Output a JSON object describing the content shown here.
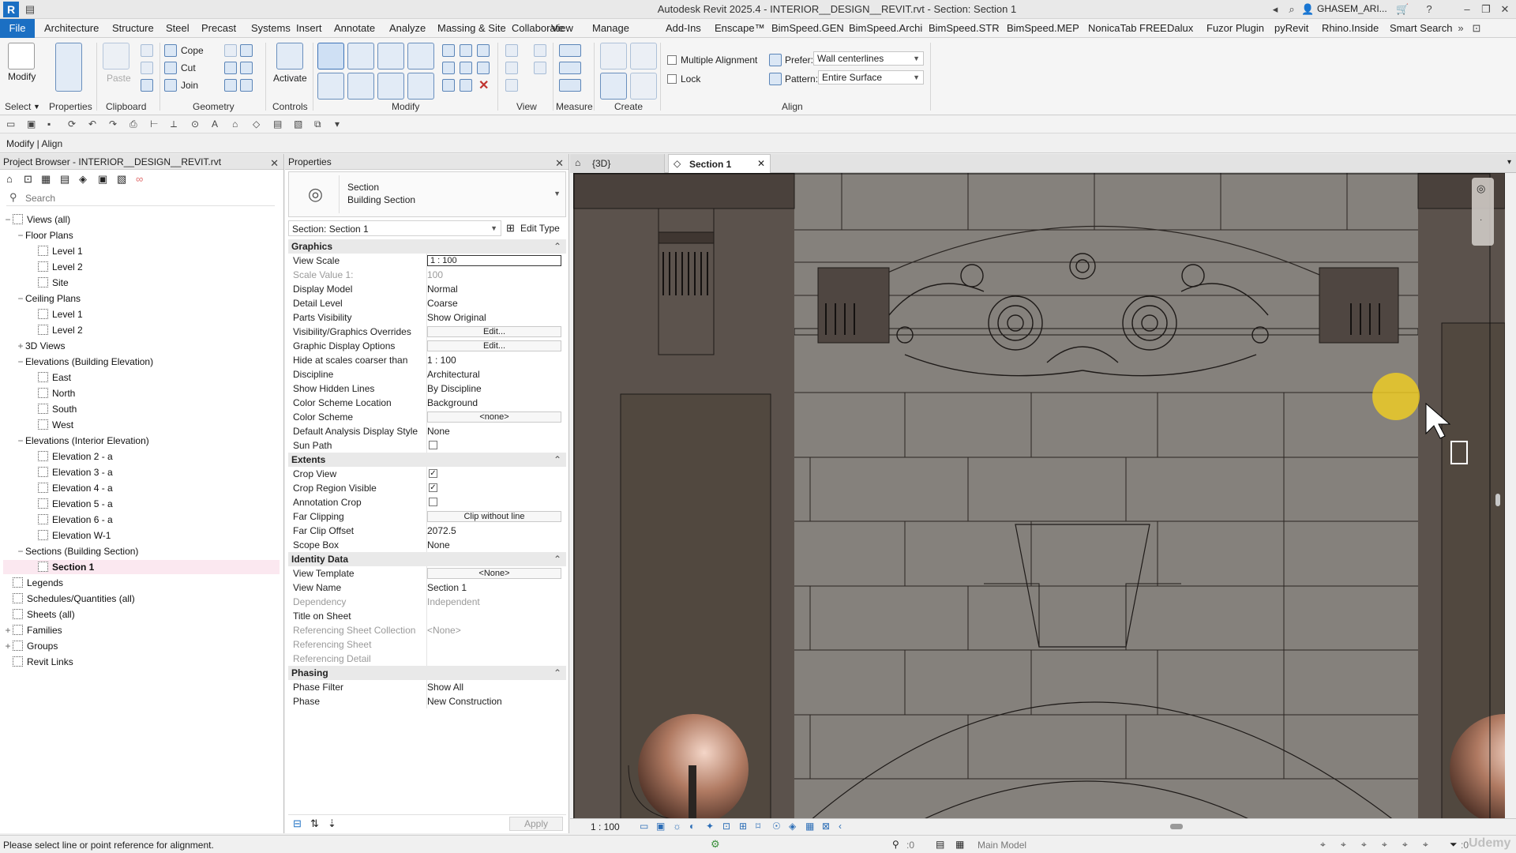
{
  "app": {
    "title": "Autodesk Revit 2025.4 - INTERIOR__DESIGN__REVIT.rvt - Section: Section 1",
    "user": "GHASEM_ARI...",
    "logo_letter": "R"
  },
  "menubar": {
    "file": "File",
    "items": [
      "Architecture",
      "Structure",
      "Steel",
      "Precast",
      "Systems",
      "Insert",
      "Annotate",
      "Analyze",
      "Massing & Site",
      "Collaborate",
      "View",
      "Manage",
      "Add-Ins",
      "Enscape™",
      "BimSpeed.GEN",
      "BimSpeed.Archi",
      "BimSpeed.STR",
      "BimSpeed.MEP",
      "NonicaTab FREE",
      "Dalux",
      "Fuzor Plugin",
      "pyRevit",
      "Rhino.Inside",
      "Smart Search"
    ]
  },
  "ribbon": {
    "modify": "Modify",
    "select": "Select",
    "properties": "Properties",
    "clipboard": "Clipboard",
    "paste": "Paste",
    "cope": "Cope",
    "cut": "Cut",
    "join": "Join",
    "geometry": "Geometry",
    "activate": "Activate",
    "controls": "Controls",
    "modify_group": "Modify",
    "view_group": "View",
    "measure_group": "Measure",
    "create_group": "Create",
    "align_group": "Align",
    "multiple_alignment": "Multiple Alignment",
    "lock": "Lock",
    "prefer_label": "Prefer:",
    "prefer_value": "Wall centerlines",
    "pattern_label": "Pattern:",
    "pattern_value": "Entire Surface"
  },
  "context": {
    "label": "Modify | Align"
  },
  "project_browser": {
    "title": "Project Browser - INTERIOR__DESIGN__REVIT.rvt",
    "search_placeholder": "Search",
    "tree": [
      {
        "label": "Views (all)",
        "level": 0,
        "twist": "−",
        "icon": true
      },
      {
        "label": "Floor Plans",
        "level": 1,
        "twist": "−",
        "icon": false
      },
      {
        "label": "Level 1",
        "level": 2,
        "twist": "",
        "icon": true
      },
      {
        "label": "Level 2",
        "level": 2,
        "twist": "",
        "icon": true
      },
      {
        "label": "Site",
        "level": 2,
        "twist": "",
        "icon": true
      },
      {
        "label": "Ceiling Plans",
        "level": 1,
        "twist": "−",
        "icon": false
      },
      {
        "label": "Level 1",
        "level": 2,
        "twist": "",
        "icon": true
      },
      {
        "label": "Level 2",
        "level": 2,
        "twist": "",
        "icon": true
      },
      {
        "label": "3D Views",
        "level": 1,
        "twist": "+",
        "icon": false
      },
      {
        "label": "Elevations (Building Elevation)",
        "level": 1,
        "twist": "−",
        "icon": false
      },
      {
        "label": "East",
        "level": 2,
        "twist": "",
        "icon": true
      },
      {
        "label": "North",
        "level": 2,
        "twist": "",
        "icon": true
      },
      {
        "label": "South",
        "level": 2,
        "twist": "",
        "icon": true
      },
      {
        "label": "West",
        "level": 2,
        "twist": "",
        "icon": true
      },
      {
        "label": "Elevations (Interior Elevation)",
        "level": 1,
        "twist": "−",
        "icon": false
      },
      {
        "label": "Elevation 2 - a",
        "level": 2,
        "twist": "",
        "icon": true
      },
      {
        "label": "Elevation 3 - a",
        "level": 2,
        "twist": "",
        "icon": true
      },
      {
        "label": "Elevation 4 - a",
        "level": 2,
        "twist": "",
        "icon": true
      },
      {
        "label": "Elevation 5 - a",
        "level": 2,
        "twist": "",
        "icon": true
      },
      {
        "label": "Elevation 6 - a",
        "level": 2,
        "twist": "",
        "icon": true
      },
      {
        "label": "Elevation W-1",
        "level": 2,
        "twist": "",
        "icon": true
      },
      {
        "label": "Sections (Building Section)",
        "level": 1,
        "twist": "−",
        "icon": false
      },
      {
        "label": "Section 1",
        "level": 2,
        "twist": "",
        "icon": true,
        "selected": true
      },
      {
        "label": "Legends",
        "level": 0,
        "twist": "",
        "icon": true
      },
      {
        "label": "Schedules/Quantities (all)",
        "level": 0,
        "twist": "",
        "icon": true
      },
      {
        "label": "Sheets (all)",
        "level": 0,
        "twist": "",
        "icon": true
      },
      {
        "label": "Families",
        "level": 0,
        "twist": "+",
        "icon": true
      },
      {
        "label": "Groups",
        "level": 0,
        "twist": "+",
        "icon": true
      },
      {
        "label": "Revit Links",
        "level": 0,
        "twist": "",
        "icon": true
      }
    ]
  },
  "properties": {
    "title": "Properties",
    "type_name": "Section",
    "type_family": "Building Section",
    "instance_selector": "Section: Section 1",
    "edit_type": "Edit Type",
    "apply": "Apply",
    "groups": [
      {
        "name": "Graphics",
        "rows": [
          {
            "k": "View Scale",
            "v": "1 : 100",
            "kind": "input"
          },
          {
            "k": "Scale Value    1:",
            "v": "100",
            "grey": true
          },
          {
            "k": "Display Model",
            "v": "Normal"
          },
          {
            "k": "Detail Level",
            "v": "Coarse"
          },
          {
            "k": "Parts Visibility",
            "v": "Show Original"
          },
          {
            "k": "Visibility/Graphics Overrides",
            "v": "Edit...",
            "kind": "button"
          },
          {
            "k": "Graphic Display Options",
            "v": "Edit...",
            "kind": "button"
          },
          {
            "k": "Hide at scales coarser than",
            "v": "1 : 100"
          },
          {
            "k": "Discipline",
            "v": "Architectural"
          },
          {
            "k": "Show Hidden Lines",
            "v": "By Discipline"
          },
          {
            "k": "Color Scheme Location",
            "v": "Background"
          },
          {
            "k": "Color Scheme",
            "v": "<none>",
            "kind": "button"
          },
          {
            "k": "Default Analysis Display Style",
            "v": "None"
          },
          {
            "k": "Sun Path",
            "v": "",
            "kind": "check",
            "checked": false
          }
        ]
      },
      {
        "name": "Extents",
        "rows": [
          {
            "k": "Crop View",
            "v": "",
            "kind": "check",
            "checked": true
          },
          {
            "k": "Crop Region Visible",
            "v": "",
            "kind": "check",
            "checked": true
          },
          {
            "k": "Annotation Crop",
            "v": "",
            "kind": "check",
            "checked": false
          },
          {
            "k": "Far Clipping",
            "v": "Clip without line",
            "kind": "button"
          },
          {
            "k": "Far Clip Offset",
            "v": "2072.5"
          },
          {
            "k": "Scope Box",
            "v": "None"
          }
        ]
      },
      {
        "name": "Identity Data",
        "rows": [
          {
            "k": "View Template",
            "v": "<None>",
            "kind": "button"
          },
          {
            "k": "View Name",
            "v": "Section 1"
          },
          {
            "k": "Dependency",
            "v": "Independent",
            "grey": true
          },
          {
            "k": "Title on Sheet",
            "v": ""
          },
          {
            "k": "Referencing Sheet Collection",
            "v": "<None>",
            "grey": true
          },
          {
            "k": "Referencing Sheet",
            "v": "",
            "grey": true
          },
          {
            "k": "Referencing Detail",
            "v": "",
            "grey": true
          }
        ]
      },
      {
        "name": "Phasing",
        "rows": [
          {
            "k": "Phase Filter",
            "v": "Show All"
          },
          {
            "k": "Phase",
            "v": "New Construction"
          }
        ]
      }
    ]
  },
  "view_tabs": {
    "tab1": "{3D}",
    "tab2": "Section 1"
  },
  "view_control": {
    "scale": "1 : 100"
  },
  "status": {
    "message": "Please select line or point reference for alignment.",
    "workset": ":0",
    "model": "Main Model",
    "filter_count": ":0"
  },
  "watermark": "Udemy"
}
